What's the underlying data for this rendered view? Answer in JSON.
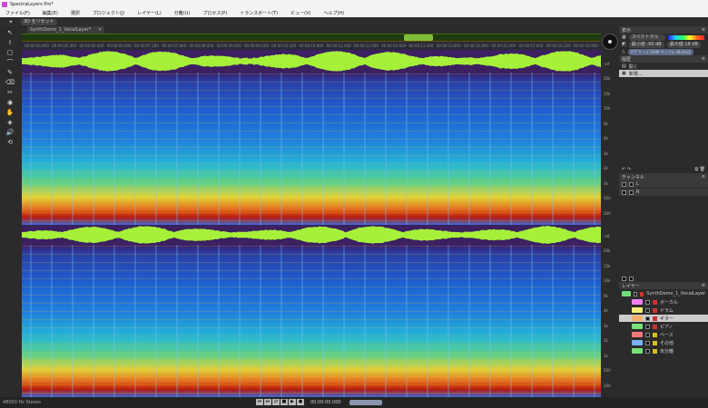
{
  "app": {
    "title": "SpectraLayers Pro*"
  },
  "menu": [
    "ファイル(F)",
    "編集(E)",
    "選択",
    "プロジェクト(J)",
    "レイヤー(L)",
    "分離(U)",
    "プロセス(P)",
    "トランスポート(T)",
    "ビュー(V)",
    "ヘルプ(H)"
  ],
  "toolbar": {
    "reset3d": "3D をリセット"
  },
  "tab": {
    "label": "SynthDemo_1_VocalLayer*",
    "close": "×"
  },
  "ruler": [
    "00:00:04.800",
    "00:00:05.400",
    "00:00:06.000",
    "00:00:06.600",
    "00:00:07.200",
    "00:00:07.800",
    "00:00:08.400",
    "00:00:09.000",
    "00:00:09.600",
    "00:00:10.200",
    "00:00:10.800",
    "00:00:11.400",
    "00:00:12.000",
    "00:00:12.600",
    "00:00:13.200",
    "00:00:13.800",
    "00:00:14.400",
    "00:00:15.000",
    "00:00:15.600",
    "00:00:16.200",
    "00:00:16.800"
  ],
  "freq_labels": [
    "20k",
    "15k",
    "10k",
    "6k",
    "4k",
    "3k",
    "2k",
    "1k",
    "500",
    "200"
  ],
  "wave_labels": [
    "-inf",
    "1"
  ],
  "display": {
    "header": "表示",
    "colormap": "スペクトラル",
    "min_label": "最小値",
    "min_val": "-90 dB",
    "max_label": "最大値",
    "max_val": "18 dB",
    "fft": "FFT サイズ 4096 サンプル (Nuttall)"
  },
  "history": {
    "header": "履歴",
    "items": [
      "開く",
      "新規..."
    ]
  },
  "channels": {
    "header": "チャンネル",
    "items": [
      "L",
      "R"
    ]
  },
  "layers": {
    "header": "レイヤー",
    "items": [
      {
        "name": "SynthDemo_1_VocalLayer",
        "color": "#6fe07a"
      },
      {
        "name": "ボーカル",
        "color": "#f080f0"
      },
      {
        "name": "ドラム",
        "color": "#f5f07a"
      },
      {
        "name": "ギター",
        "color": "#f5b070"
      },
      {
        "name": "ピアノ",
        "color": "#7ae07a"
      },
      {
        "name": "ベース",
        "color": "#f07a7a"
      },
      {
        "name": "その他",
        "color": "#7ab0f5"
      },
      {
        "name": "未分離",
        "color": "#7ae07a"
      }
    ]
  },
  "status": {
    "format": "48000 Hz Stereo",
    "timecode": "00:00:00.000"
  },
  "transport": [
    "⏮",
    "⏭",
    "⇄",
    "■",
    "▶",
    "●"
  ]
}
